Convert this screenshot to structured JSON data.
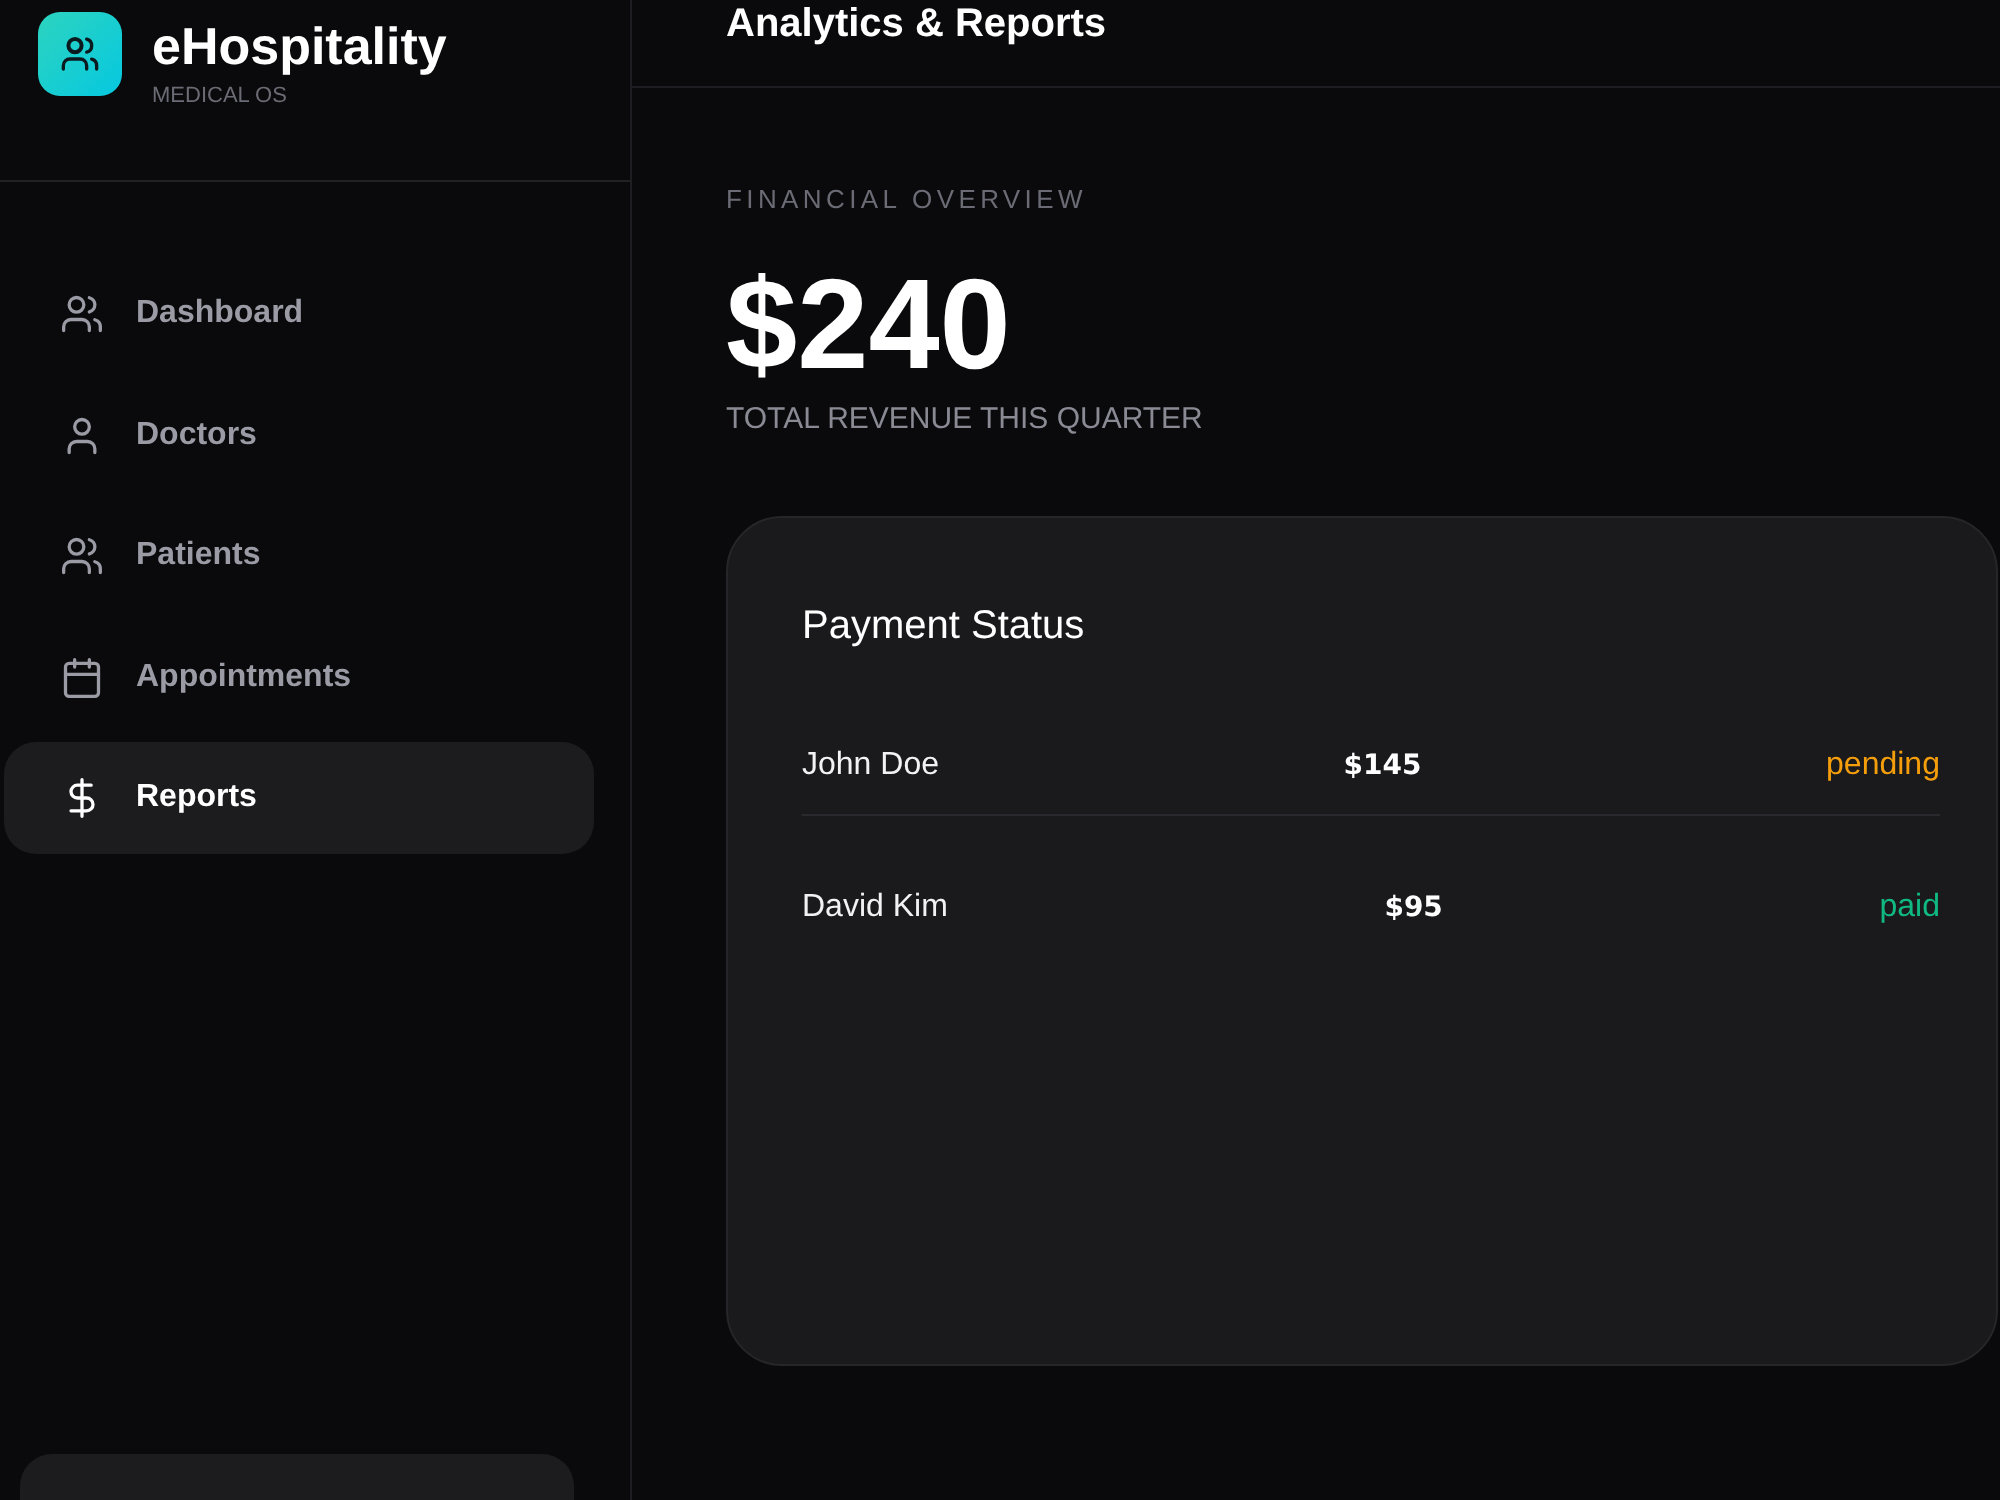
{
  "sidebar": {
    "brand": {
      "name": "eHospitality",
      "tagline": "MEDICAL OS"
    },
    "nav": [
      {
        "label": "Dashboard",
        "selected": false
      },
      {
        "label": "Doctors",
        "selected": false
      },
      {
        "label": "Patients",
        "selected": false
      },
      {
        "label": "Appointments",
        "selected": false
      },
      {
        "label": "Reports",
        "selected": true
      }
    ]
  },
  "header": {
    "title": "Analytics & Reports"
  },
  "overview": {
    "eyebrow": "FINANCIAL OVERVIEW",
    "total": "$240",
    "caption": "TOTAL REVENUE THIS QUARTER"
  },
  "payments": {
    "title": "Payment Status",
    "rows": [
      {
        "name": "John Doe",
        "amount": "$145",
        "status": "pending",
        "color": "#f59e0b"
      },
      {
        "name": "David Kim",
        "amount": "$95",
        "status": "paid",
        "color": "#10b981"
      }
    ]
  }
}
